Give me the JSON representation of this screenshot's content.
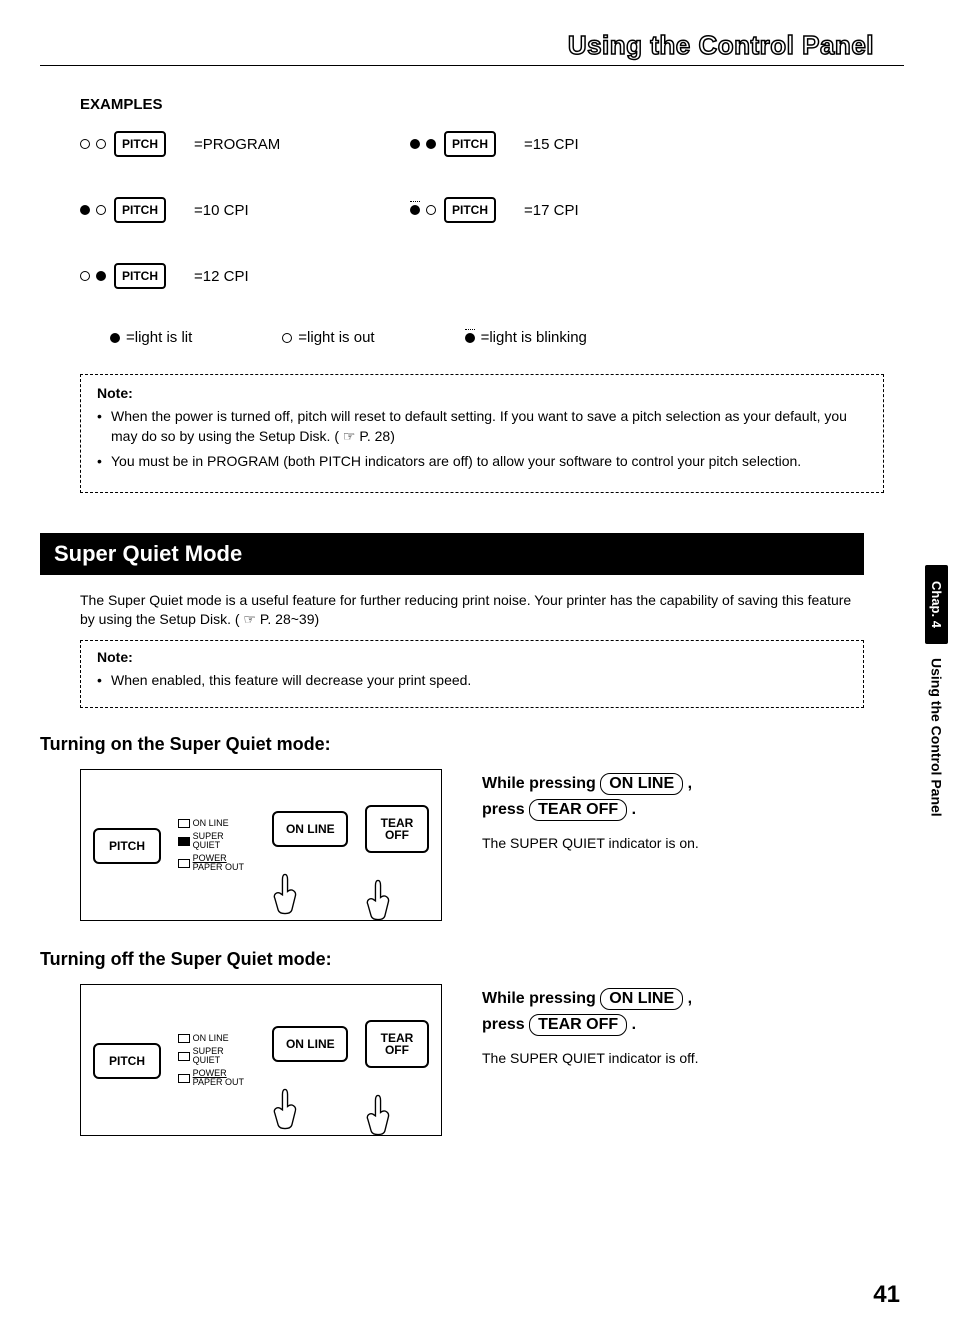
{
  "header": {
    "title": "Using the Control Panel"
  },
  "examples": {
    "heading": "EXAMPLES",
    "button": "PITCH",
    "rows": [
      [
        {
          "led1": "off",
          "led2": "off",
          "label": "=PROGRAM"
        },
        {
          "led1": "on",
          "led2": "on",
          "label": "=15 CPI"
        }
      ],
      [
        {
          "led1": "on",
          "led2": "off",
          "label": "=10 CPI"
        },
        {
          "led1": "blink",
          "led2": "off",
          "label": "=17 CPI"
        }
      ],
      [
        {
          "led1": "off",
          "led2": "on",
          "label": "=12 CPI"
        }
      ]
    ],
    "legend": {
      "lit": "=light is lit",
      "out": "=light is out",
      "blink": "=light is blinking"
    }
  },
  "note1": {
    "title": "Note:",
    "items": [
      "When the power is turned off, pitch will reset to default setting. If you want to save a pitch selection as your default, you may do so by using the Setup Disk. ( ☞  P. 28)",
      "You must be in PROGRAM (both PITCH indicators are off) to allow your software to control your pitch selection."
    ]
  },
  "section": {
    "title": "Super Quiet Mode",
    "intro": "The Super Quiet mode is a useful feature for further reducing print noise. Your printer has the capability of saving this feature by using the Setup Disk. ( ☞  P. 28~39)"
  },
  "note2": {
    "title": "Note:",
    "items": [
      "When enabled, this feature will decrease your print speed."
    ]
  },
  "turn_on": {
    "heading": "Turning on the Super Quiet mode:",
    "panel": {
      "pitch": "PITCH",
      "online_btn": "ON LINE",
      "tear_btn_line1": "TEAR",
      "tear_btn_line2": "OFF",
      "ind_online": "ON LINE",
      "ind_sq_line1": "SUPER",
      "ind_sq_line2": "QUIET",
      "ind_power_line1": "POWER",
      "ind_power_line2": "PAPER OUT",
      "sq_filled": true
    },
    "desc": {
      "line1a": "While pressing ",
      "btn1": "ON LINE",
      "line1b": " ,",
      "line2a": "press ",
      "btn2": "TEAR OFF",
      "line2b": " .",
      "sub": "The SUPER QUIET indicator is on."
    }
  },
  "turn_off": {
    "heading": "Turning off the Super Quiet mode:",
    "panel": {
      "pitch": "PITCH",
      "online_btn": "ON LINE",
      "tear_btn_line1": "TEAR",
      "tear_btn_line2": "OFF",
      "ind_online": "ON LINE",
      "ind_sq_line1": "SUPER",
      "ind_sq_line2": "QUIET",
      "ind_power_line1": "POWER",
      "ind_power_line2": "PAPER OUT",
      "sq_filled": false
    },
    "desc": {
      "line1a": "While pressing ",
      "btn1": "ON LINE",
      "line1b": " ,",
      "line2a": "press ",
      "btn2": "TEAR OFF",
      "line2b": " .",
      "sub": "The SUPER QUIET indicator is off."
    }
  },
  "side": {
    "chap": "Chap. 4",
    "text": "Using the Control Panel"
  },
  "page_number": "41"
}
